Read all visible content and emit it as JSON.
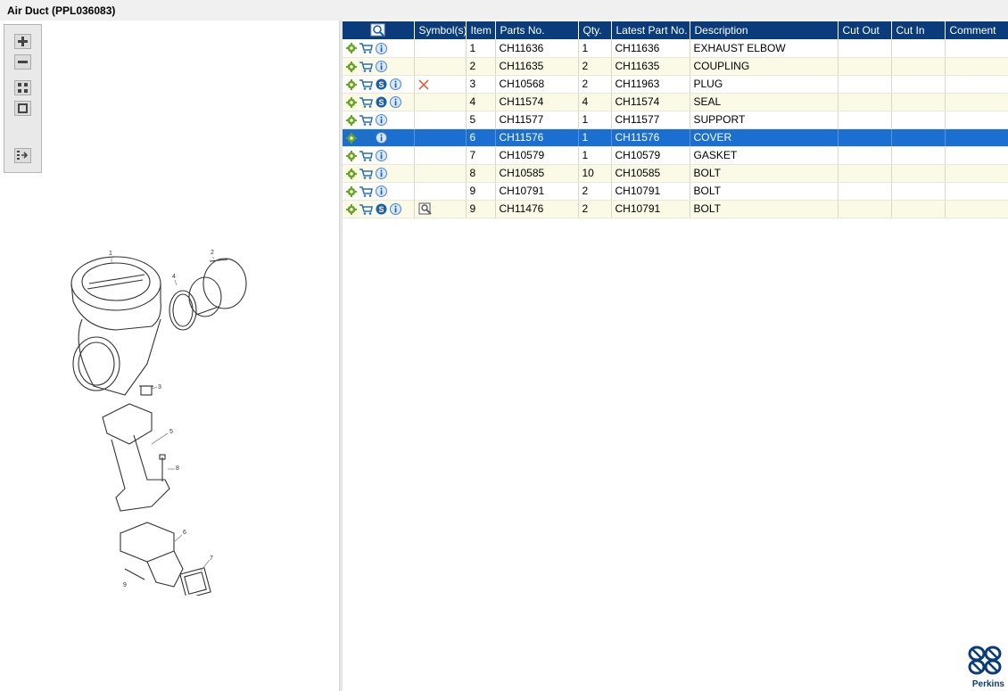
{
  "window": {
    "title": "Air Duct (PPL036083)"
  },
  "toolbox": {
    "tools": [
      "zoom-in-icon",
      "zoom-out-icon",
      "fit-window-icon",
      "actual-size-icon",
      "toggle-panel-icon"
    ]
  },
  "drawing": {
    "callouts": [
      "1",
      "2",
      "4",
      "3",
      "5",
      "8",
      "6",
      "7",
      "9"
    ]
  },
  "table": {
    "columns": [
      "",
      "Symbol(s)",
      "Item",
      "Parts No.",
      "Qty.",
      "Latest Part No.",
      "Description",
      "Cut Out",
      "Cut In",
      "Comment"
    ],
    "rows": [
      {
        "item": "1",
        "parts_no": "CH11636",
        "qty": "1",
        "latest": "CH11636",
        "desc": "EXHAUST ELBOW",
        "s": false,
        "symbol": ""
      },
      {
        "item": "2",
        "parts_no": "CH11635",
        "qty": "2",
        "latest": "CH11635",
        "desc": "COUPLING",
        "s": false,
        "symbol": ""
      },
      {
        "item": "3",
        "parts_no": "CH10568",
        "qty": "2",
        "latest": "CH11963",
        "desc": "PLUG",
        "s": true,
        "symbol": "x"
      },
      {
        "item": "4",
        "parts_no": "CH11574",
        "qty": "4",
        "latest": "CH11574",
        "desc": "SEAL",
        "s": true,
        "symbol": ""
      },
      {
        "item": "5",
        "parts_no": "CH11577",
        "qty": "1",
        "latest": "CH11577",
        "desc": "SUPPORT",
        "s": false,
        "symbol": ""
      },
      {
        "item": "6",
        "parts_no": "CH11576",
        "qty": "1",
        "latest": "CH11576",
        "desc": "COVER",
        "s": false,
        "symbol": "",
        "selected": true
      },
      {
        "item": "7",
        "parts_no": "CH10579",
        "qty": "1",
        "latest": "CH10579",
        "desc": "GASKET",
        "s": false,
        "symbol": ""
      },
      {
        "item": "8",
        "parts_no": "CH10585",
        "qty": "10",
        "latest": "CH10585",
        "desc": "BOLT",
        "s": false,
        "symbol": ""
      },
      {
        "item": "9",
        "parts_no": "CH10791",
        "qty": "2",
        "latest": "CH10791",
        "desc": "BOLT",
        "s": false,
        "symbol": ""
      },
      {
        "item": "9",
        "parts_no": "CH11476",
        "qty": "2",
        "latest": "CH10791",
        "desc": "BOLT",
        "s": true,
        "symbol": "view"
      }
    ]
  },
  "brand": {
    "name": "Perkins",
    "color": "#0a3b7a"
  },
  "colors": {
    "header": "#0a3b7a",
    "selected_row": "#1a6fd1",
    "alt_row": "#fafae6"
  }
}
